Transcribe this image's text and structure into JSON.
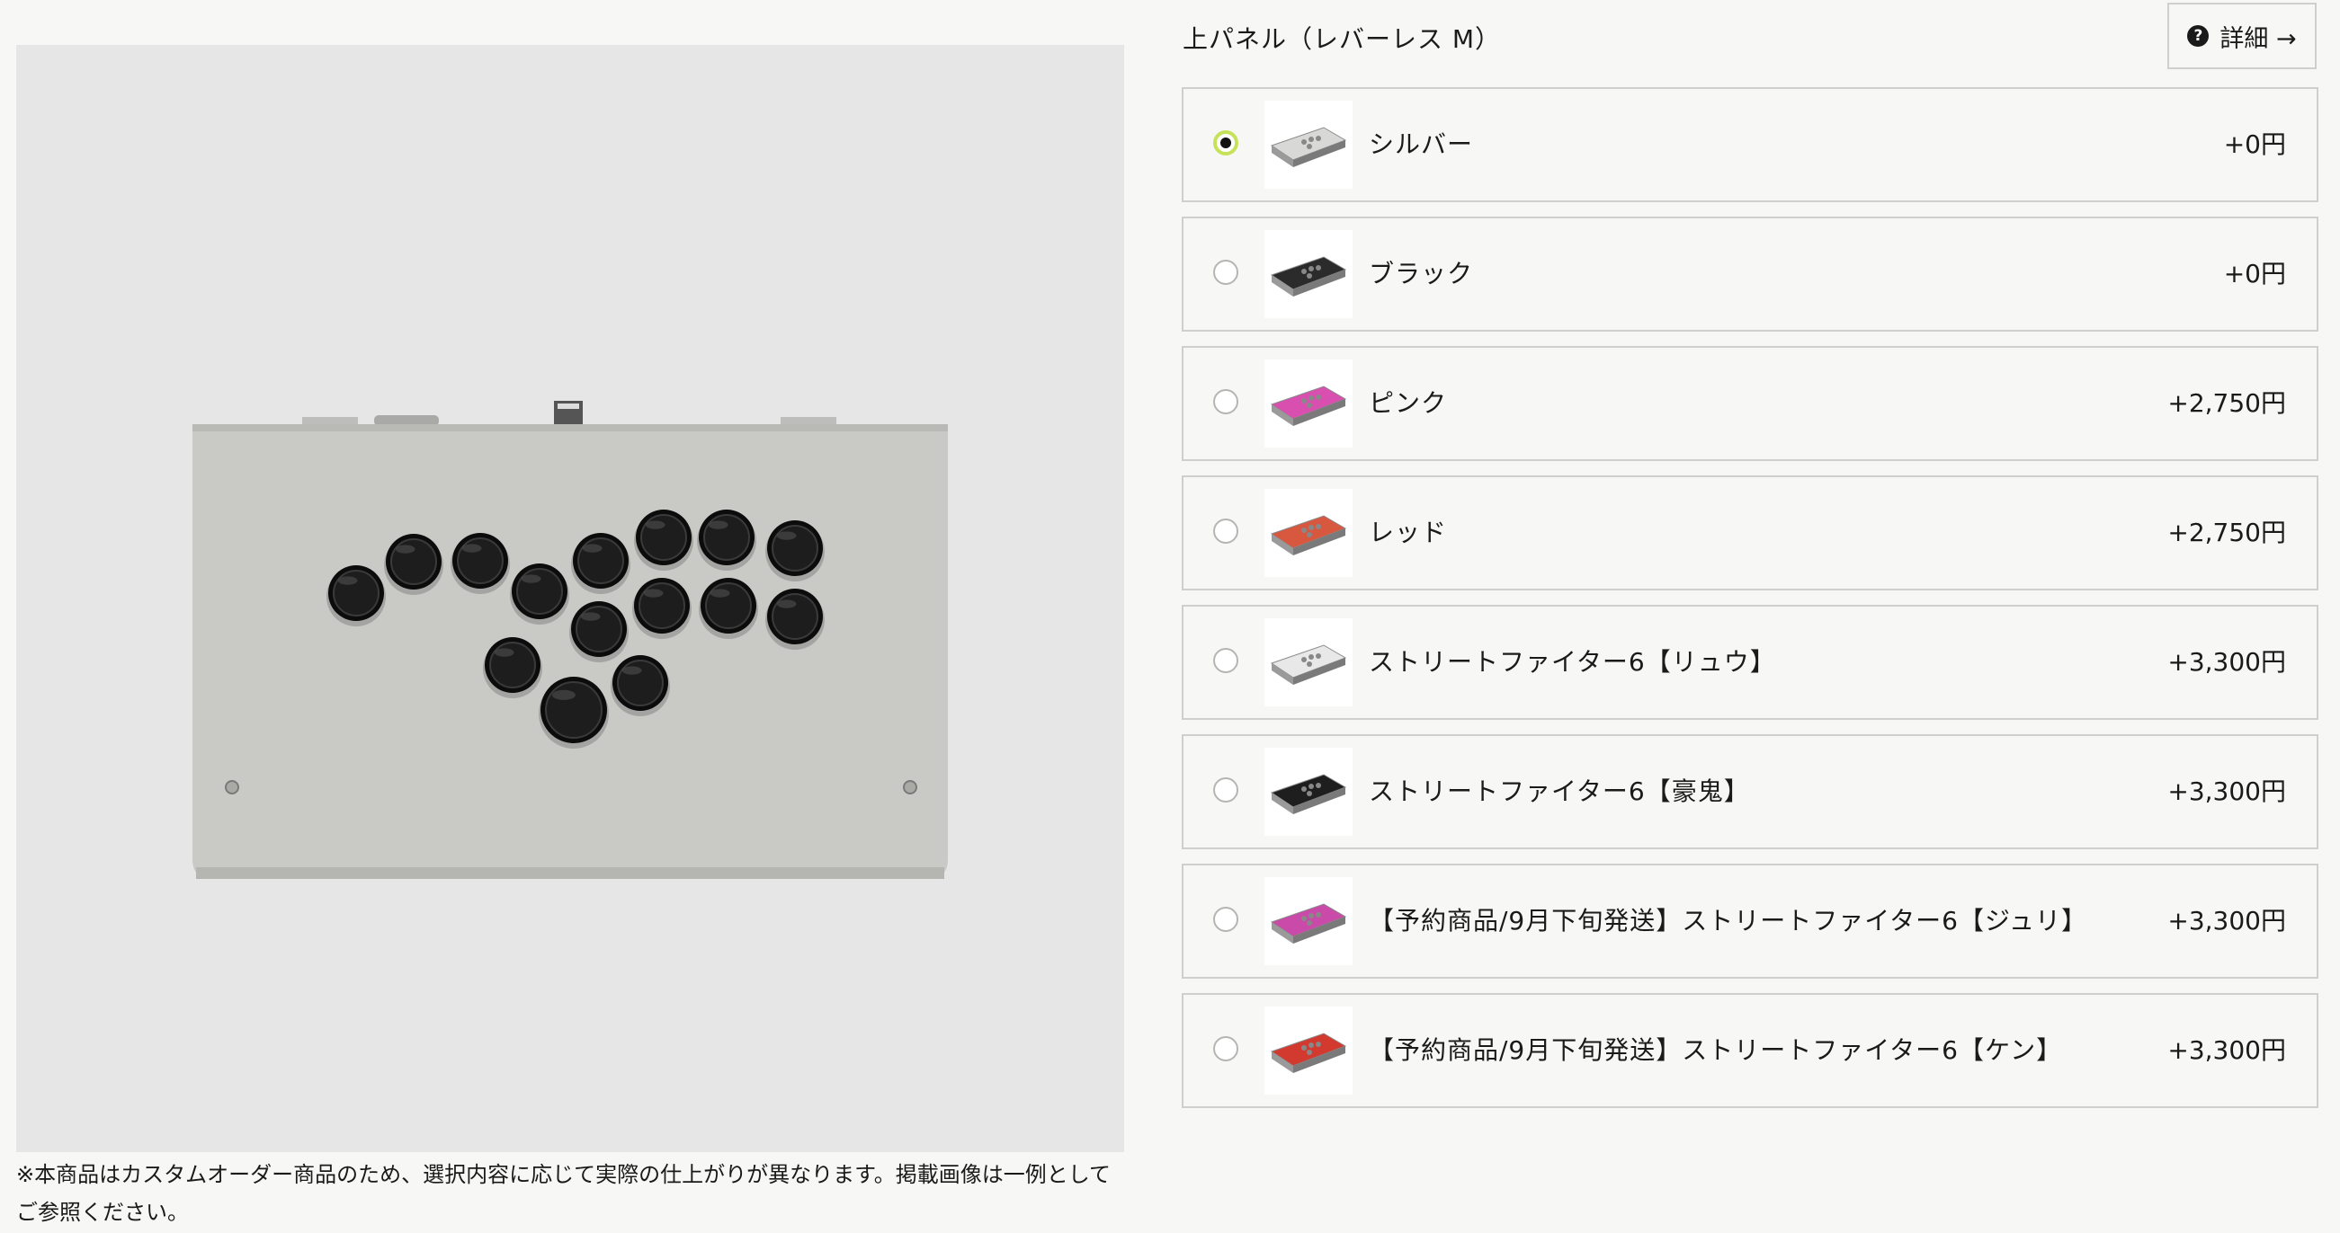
{
  "section": {
    "title": "上パネル（レバーレス M）"
  },
  "detail": {
    "label": "詳細 →",
    "icon": "help-circle-icon"
  },
  "colors": {
    "selected_ring": "#c6e25a",
    "border": "#cfcfcf",
    "preview_bg": "#e6e6e6"
  },
  "options": [
    {
      "label": "シルバー",
      "price": "+0円",
      "selected": true,
      "color": "#d8d8d6"
    },
    {
      "label": "ブラック",
      "price": "+0円",
      "selected": false,
      "color": "#2b2b2b"
    },
    {
      "label": "ピンク",
      "price": "+2,750円",
      "selected": false,
      "color": "#d94fb0"
    },
    {
      "label": "レッド",
      "price": "+2,750円",
      "selected": false,
      "color": "#d8573f"
    },
    {
      "label": "ストリートファイター6【リュウ】",
      "price": "+3,300円",
      "selected": false,
      "color": "#e8e8e8"
    },
    {
      "label": "ストリートファイター6【豪鬼】",
      "price": "+3,300円",
      "selected": false,
      "color": "#1e1e1e"
    },
    {
      "label": "【予約商品/9月下旬発送】ストリートファイター6【ジュリ】",
      "price": "+3,300円",
      "selected": false,
      "color": "#c94aa8"
    },
    {
      "label": "【予約商品/9月下旬発送】ストリートファイター6【ケン】",
      "price": "+3,300円",
      "selected": false,
      "color": "#d33a2f"
    }
  ],
  "notice": "※本商品はカスタムオーダー商品のため、選択内容に応じて実際の仕上がりが異なります。掲載画像は一例として ご参照ください。"
}
